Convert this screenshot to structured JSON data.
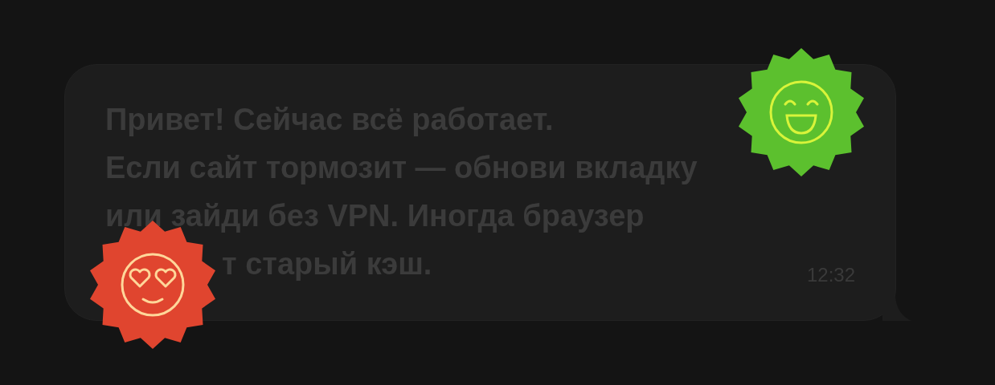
{
  "message": {
    "lines": [
      "Привет! Сейчас всё работает.",
      "Если сайт тормозит — обнови вкладку",
      "или зайди без VPN. Иногда браузер",
      "т старый кэш."
    ],
    "time": "12:32"
  },
  "stickers": [
    {
      "kind": "grin",
      "color": "#5cc02e"
    },
    {
      "kind": "heart-eyes",
      "color": "#e0452f"
    }
  ]
}
